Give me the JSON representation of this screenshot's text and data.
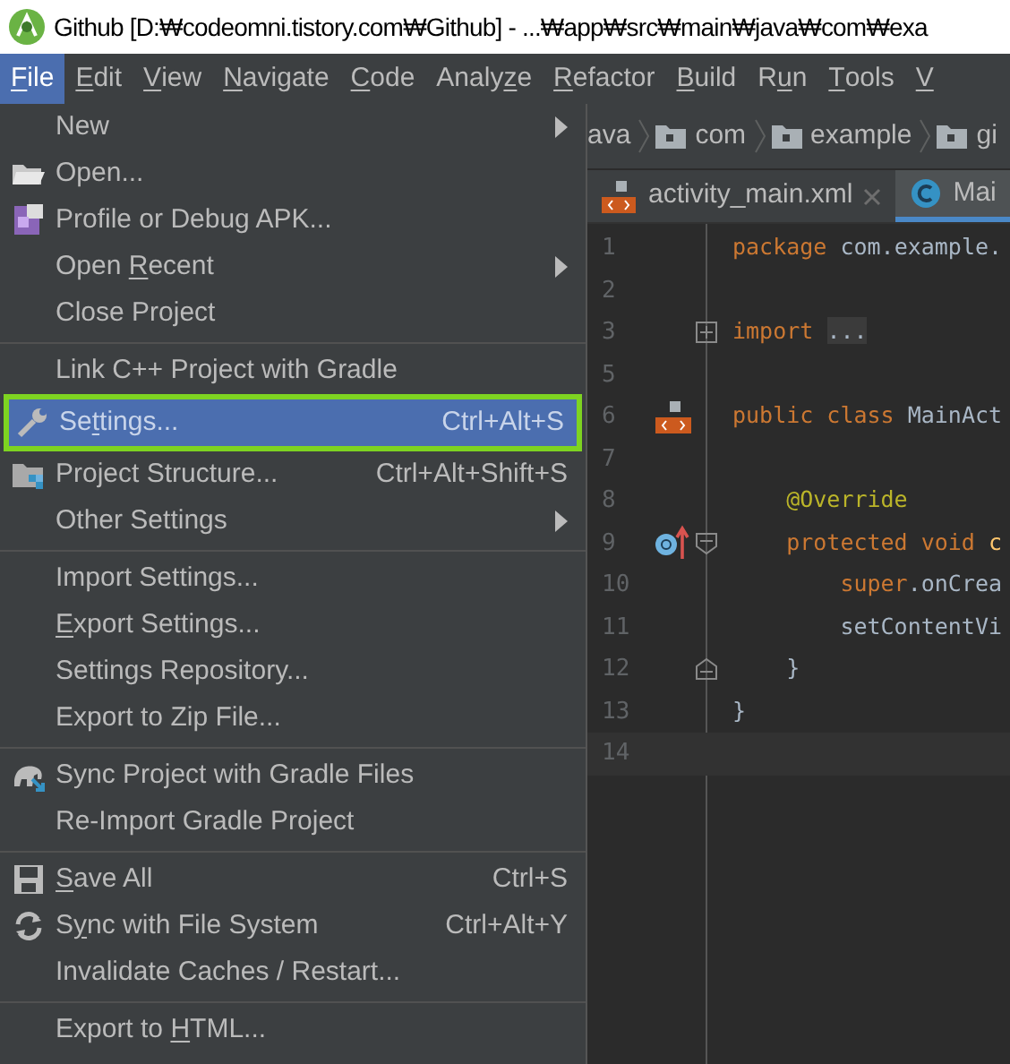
{
  "window": {
    "title": "Github [D:₩codeomni.tistory.com₩Github] - ...₩app₩src₩main₩java₩com₩exa"
  },
  "menu_bar": [
    {
      "label": [
        {
          "text": "F",
          "mnemonic": true
        },
        {
          "text": "ile"
        }
      ],
      "selected": true
    },
    {
      "label": [
        {
          "text": "E",
          "mnemonic": true
        },
        {
          "text": "dit"
        }
      ],
      "selected": false
    },
    {
      "label": [
        {
          "text": "V",
          "mnemonic": true
        },
        {
          "text": "iew"
        }
      ],
      "selected": false
    },
    {
      "label": [
        {
          "text": "N",
          "mnemonic": true
        },
        {
          "text": "avigate"
        }
      ],
      "selected": false
    },
    {
      "label": [
        {
          "text": "C",
          "mnemonic": true
        },
        {
          "text": "ode"
        }
      ],
      "selected": false
    },
    {
      "label": [
        {
          "text": "Analy"
        },
        {
          "text": "z",
          "mnemonic": true
        },
        {
          "text": "e"
        }
      ],
      "selected": false
    },
    {
      "label": [
        {
          "text": "R",
          "mnemonic": true
        },
        {
          "text": "efactor"
        }
      ],
      "selected": false
    },
    {
      "label": [
        {
          "text": "B",
          "mnemonic": true
        },
        {
          "text": "uild"
        }
      ],
      "selected": false
    },
    {
      "label": [
        {
          "text": "R"
        },
        {
          "text": "u",
          "mnemonic": true
        },
        {
          "text": "n"
        }
      ],
      "selected": false
    },
    {
      "label": [
        {
          "text": "T",
          "mnemonic": true
        },
        {
          "text": "ools"
        }
      ],
      "selected": false
    },
    {
      "label": [
        {
          "text": "V",
          "mnemonic": true
        }
      ],
      "selected": false
    }
  ],
  "file_menu": [
    [
      {
        "label": [
          {
            "text": "New"
          }
        ],
        "submenu": true,
        "selected": false
      },
      {
        "label": [
          {
            "text": "Open..."
          }
        ],
        "selected": false
      },
      {
        "label": [
          {
            "text": "Profile or Debug APK..."
          }
        ],
        "selected": false
      },
      {
        "label": [
          {
            "text": "Open "
          },
          {
            "text": "R",
            "mnemonic": true
          },
          {
            "text": "ecent"
          }
        ],
        "submenu": true,
        "selected": false
      },
      {
        "label": [
          {
            "text": "Close Project"
          }
        ],
        "selected": false
      }
    ],
    [
      {
        "label": [
          {
            "text": "Link C++ Project with Gradle"
          }
        ],
        "selected": false
      },
      {
        "label": [
          {
            "text": "Se"
          },
          {
            "text": "t",
            "mnemonic": true
          },
          {
            "text": "tings..."
          }
        ],
        "shortcut": "Ctrl+Alt+S",
        "selected": true,
        "outlined": true
      },
      {
        "label": [
          {
            "text": "Project Structure..."
          }
        ],
        "shortcut": "Ctrl+Alt+Shift+S",
        "selected": false
      },
      {
        "label": [
          {
            "text": "Other Settings"
          }
        ],
        "submenu": true,
        "selected": false
      }
    ],
    [
      {
        "label": [
          {
            "text": "Import Settings..."
          }
        ],
        "selected": false
      },
      {
        "label": [
          {
            "text": "E",
            "mnemonic": true
          },
          {
            "text": "xport Settings..."
          }
        ],
        "selected": false
      },
      {
        "label": [
          {
            "text": "Settings Repository..."
          }
        ],
        "selected": false
      },
      {
        "label": [
          {
            "text": "Export to Zip File..."
          }
        ],
        "selected": false
      }
    ],
    [
      {
        "label": [
          {
            "text": "Sync Project with Gradle Files"
          }
        ],
        "selected": false
      },
      {
        "label": [
          {
            "text": "Re-Import Gradle Project"
          }
        ],
        "selected": false
      }
    ],
    [
      {
        "label": [
          {
            "text": "S",
            "mnemonic": true
          },
          {
            "text": "ave All"
          }
        ],
        "shortcut": "Ctrl+S",
        "selected": false
      },
      {
        "label": [
          {
            "text": "S"
          },
          {
            "text": "y",
            "mnemonic": true
          },
          {
            "text": "nc with File System"
          }
        ],
        "shortcut": "Ctrl+Alt+Y",
        "selected": false
      },
      {
        "label": [
          {
            "text": "Invalidate Caches / Restart..."
          }
        ],
        "selected": false
      }
    ],
    [
      {
        "label": [
          {
            "text": "Export to "
          },
          {
            "text": "H",
            "mnemonic": true
          },
          {
            "text": "TML..."
          }
        ],
        "selected": false
      }
    ]
  ],
  "breadcrumbs": [
    "ava",
    "com",
    "example",
    "gi"
  ],
  "editor_tabs": [
    {
      "label": "activity_main.xml",
      "closable": true,
      "selected": false
    },
    {
      "label": "Mai",
      "selected": true
    }
  ],
  "code_lines": [
    {
      "number": "1",
      "kind": "code",
      "tokens": [
        {
          "kind": "keyword",
          "text": "package"
        },
        {
          "kind": "plain",
          "text": " com.example."
        }
      ]
    },
    {
      "number": "2",
      "kind": "code"
    },
    {
      "number": "3",
      "kind": "fold_collapsed",
      "tokens": [
        {
          "kind": "keyword",
          "text": "import "
        },
        {
          "kind": "folded",
          "text": "..."
        }
      ]
    },
    {
      "number": "5",
      "kind": "code"
    },
    {
      "number": "6",
      "kind": "code",
      "tokens": [
        {
          "kind": "keyword",
          "text": "public class "
        },
        {
          "kind": "plain",
          "text": "MainAct"
        }
      ]
    },
    {
      "number": "7",
      "kind": "code"
    },
    {
      "number": "8",
      "kind": "code",
      "tokens": [
        {
          "kind": "annotation",
          "text": "    @Override"
        }
      ]
    },
    {
      "number": "9",
      "kind": "fold_start",
      "tokens": [
        {
          "kind": "keyword",
          "text": "    protected void "
        },
        {
          "kind": "method",
          "text": "c"
        }
      ]
    },
    {
      "number": "10",
      "kind": "code",
      "tokens": [
        {
          "kind": "keyword",
          "text": "        super"
        },
        {
          "kind": "plain",
          "text": ".onCrea"
        }
      ]
    },
    {
      "number": "11",
      "kind": "code",
      "tokens": [
        {
          "kind": "plain",
          "text": "        setContentVi"
        }
      ]
    },
    {
      "number": "12",
      "kind": "fold_end",
      "tokens": [
        {
          "kind": "plain",
          "text": "    }"
        }
      ]
    },
    {
      "number": "13",
      "kind": "code",
      "tokens": [
        {
          "kind": "plain",
          "text": "}"
        }
      ]
    },
    {
      "number": "14",
      "kind": "code",
      "current": true
    }
  ]
}
